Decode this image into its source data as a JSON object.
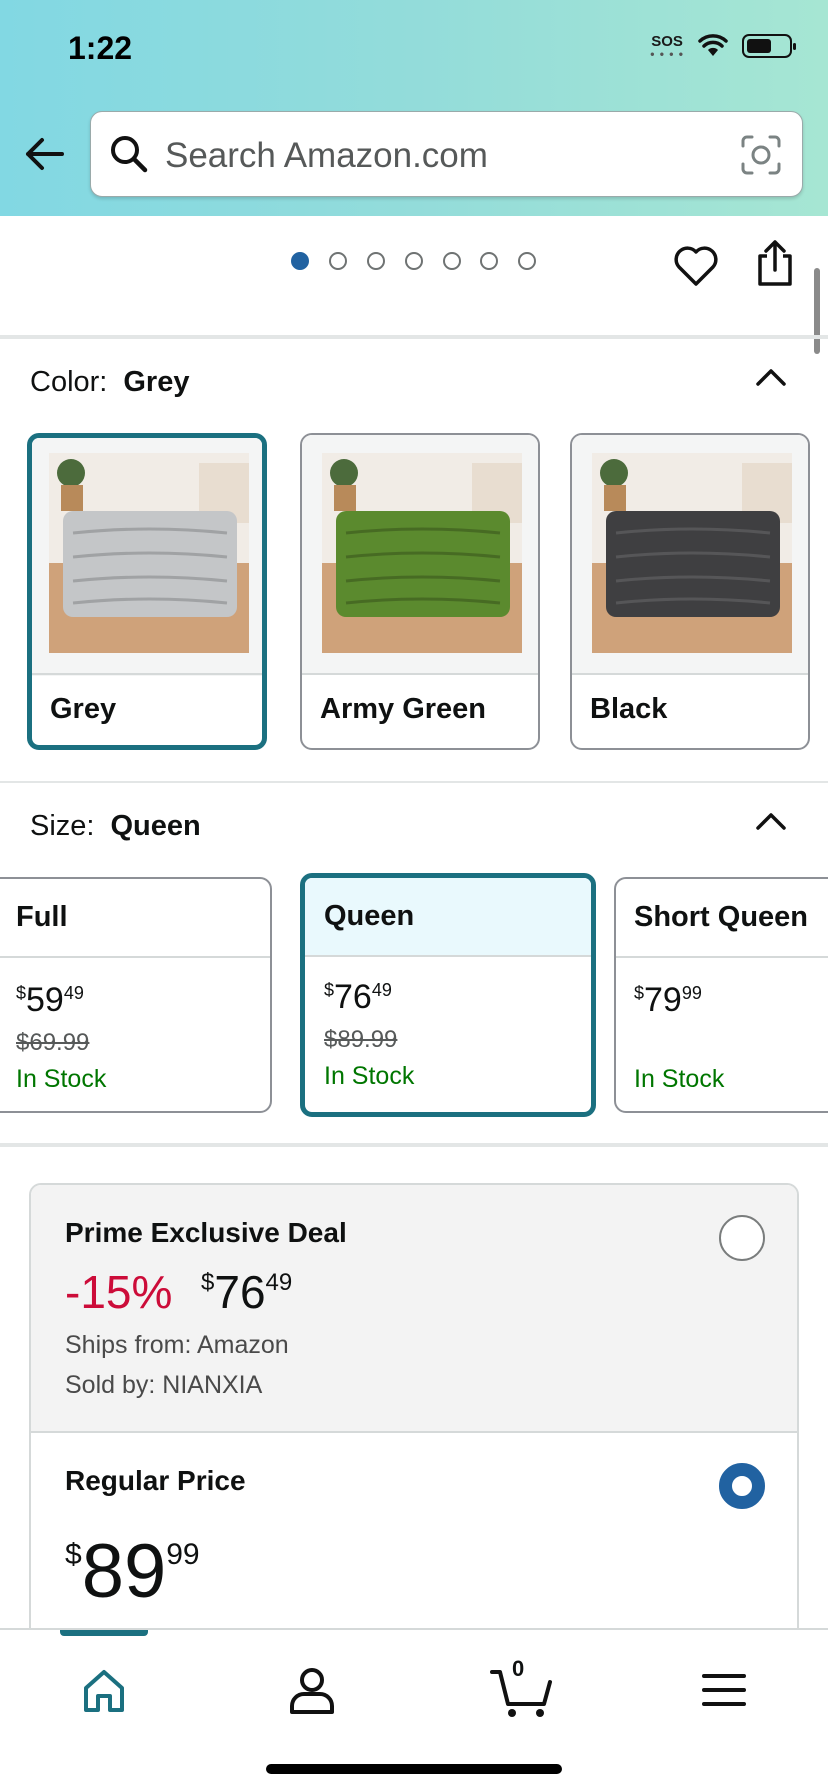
{
  "status_bar": {
    "time": "1:22",
    "sos": "SOS"
  },
  "search": {
    "placeholder": "Search Amazon.com"
  },
  "carousel": {
    "total_pages": 7,
    "active_page": 1
  },
  "color": {
    "label": "Color:",
    "selected": "Grey",
    "options": [
      {
        "label": "Grey",
        "mat_color": "#c4c6c8"
      },
      {
        "label": "Army Green",
        "mat_color": "#5b8a2e"
      },
      {
        "label": "Black",
        "mat_color": "#3f3f41"
      }
    ]
  },
  "size": {
    "label": "Size:",
    "selected": "Queen",
    "options": [
      {
        "name": "Full",
        "currency": "$",
        "whole": "59",
        "fraction": "49",
        "list_price": "$69.99",
        "stock": "In Stock"
      },
      {
        "name": "Queen",
        "currency": "$",
        "whole": "76",
        "fraction": "49",
        "list_price": "$89.99",
        "stock": "In Stock"
      },
      {
        "name": "Short Queen",
        "currency": "$",
        "whole": "79",
        "fraction": "99",
        "list_price": "",
        "stock": "In Stock"
      }
    ]
  },
  "buybox": {
    "deal": {
      "title": "Prime Exclusive Deal",
      "discount": "-15%",
      "currency": "$",
      "whole": "76",
      "fraction": "49",
      "ships_from": "Ships from: Amazon",
      "sold_by": "Sold by: NIANXIA",
      "selected": false
    },
    "regular": {
      "title": "Regular Price",
      "currency": "$",
      "whole": "89",
      "fraction": "99",
      "selected": true
    }
  },
  "bottom_nav": {
    "items": [
      "home-icon",
      "account-icon",
      "cart-icon",
      "menu-icon"
    ],
    "cart_count": "0"
  },
  "colors": {
    "accent_teal": "#1b7080",
    "link_blue": "#2162a1",
    "deal_red": "#cc0c39",
    "stock_green": "#007600"
  }
}
